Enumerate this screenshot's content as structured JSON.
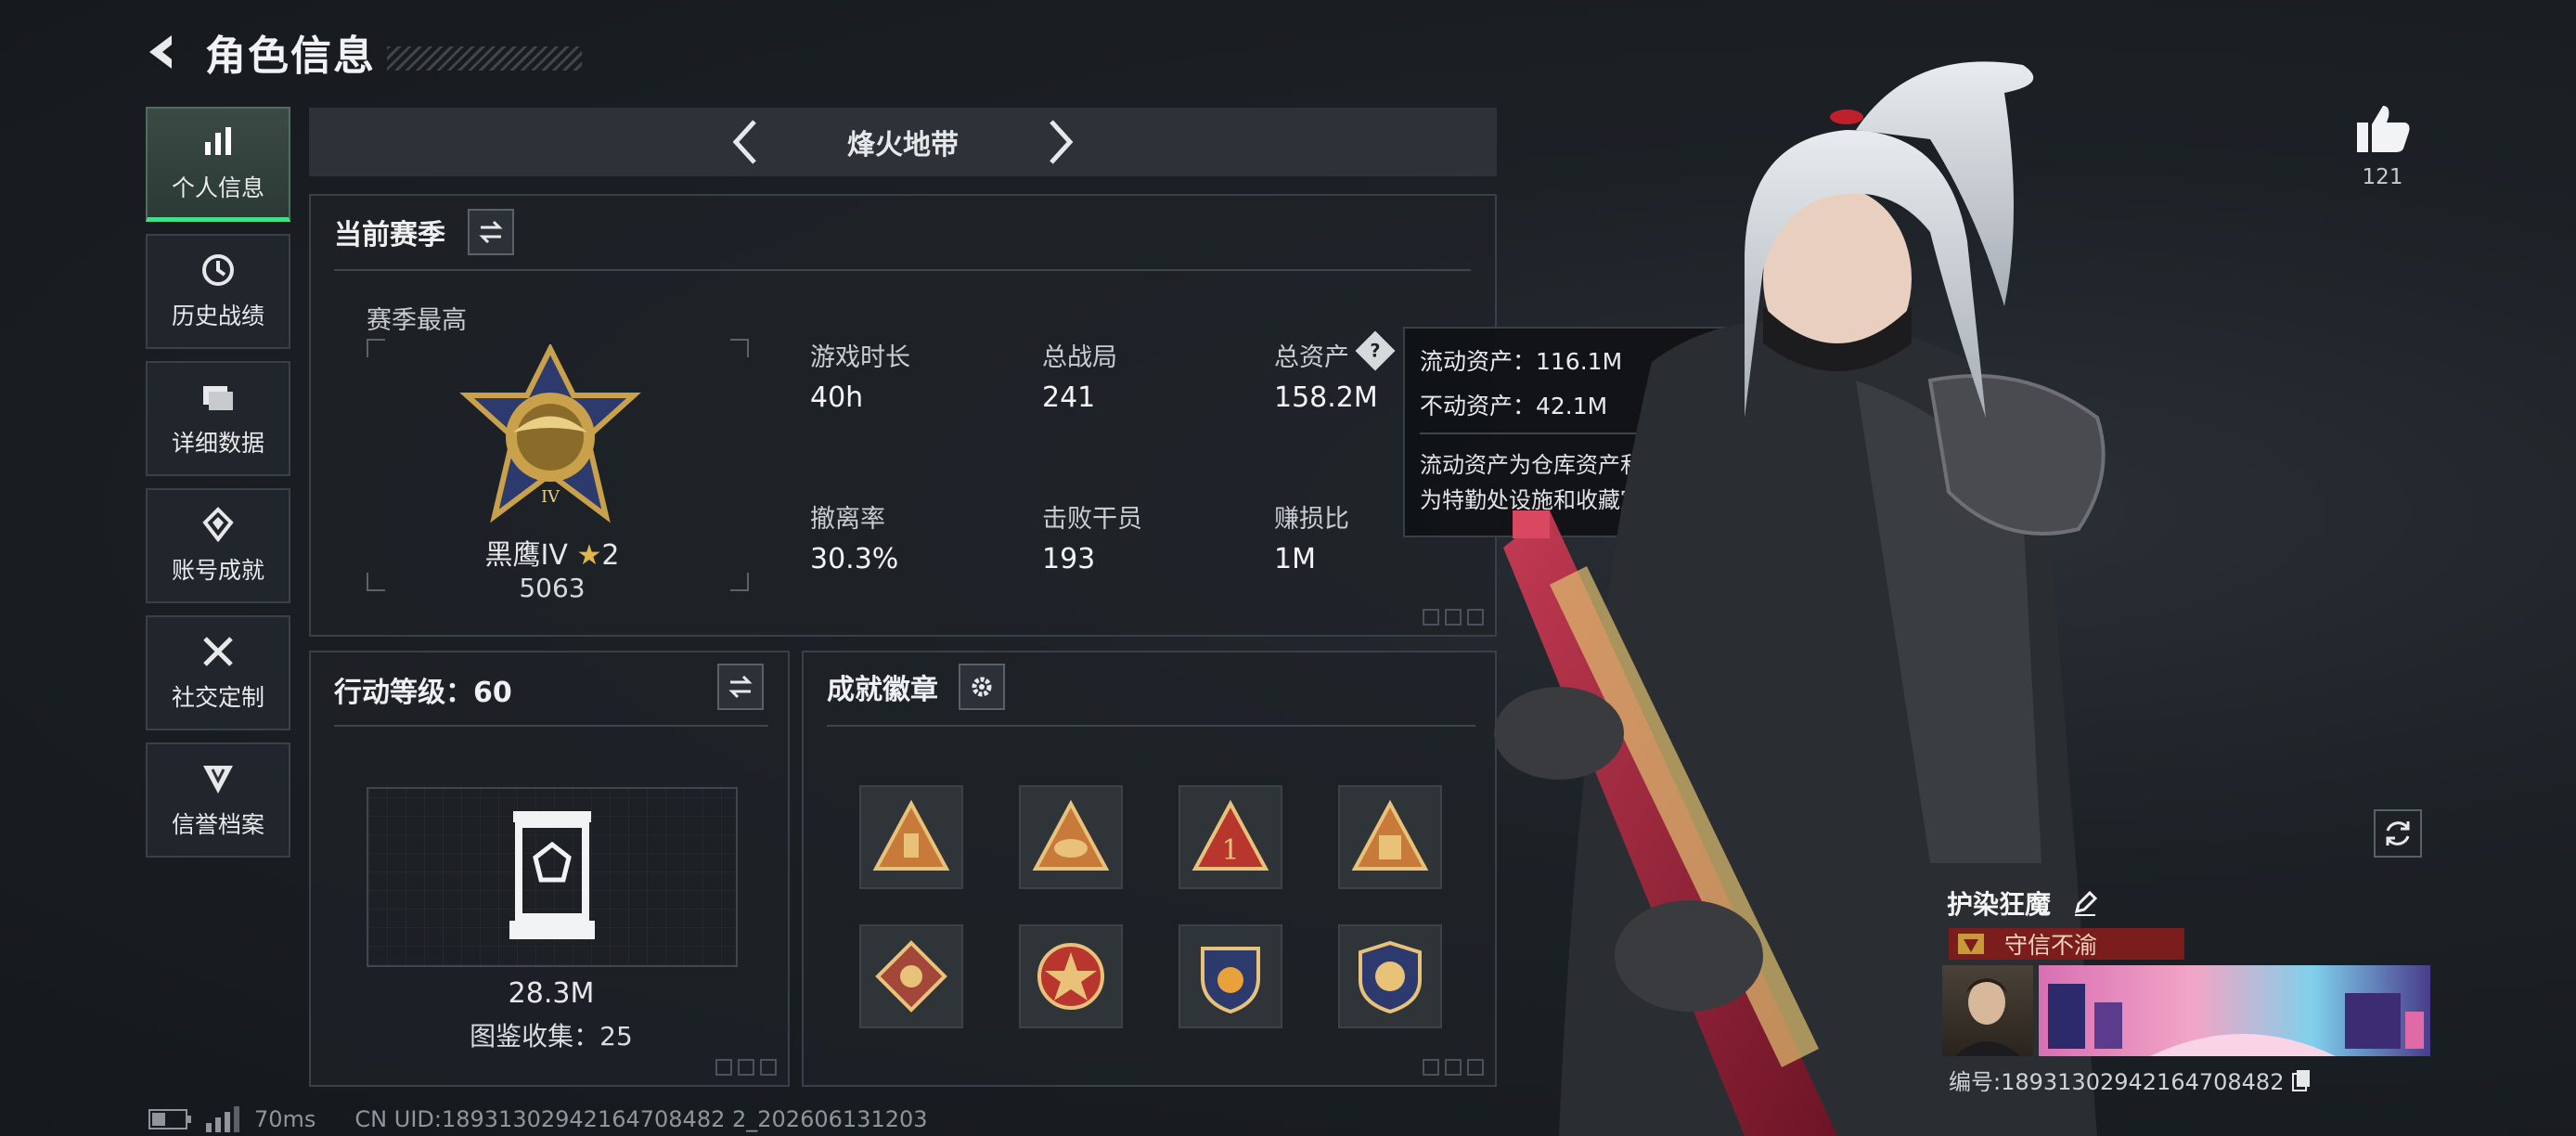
{
  "header": {
    "title": "角色信息"
  },
  "sidebar": {
    "items": [
      {
        "label": "个人信息",
        "icon": "bar-chart-icon",
        "active": true
      },
      {
        "label": "历史战绩",
        "icon": "history-clock-icon"
      },
      {
        "label": "详细数据",
        "icon": "folder-icon"
      },
      {
        "label": "账号成就",
        "icon": "achievement-icon"
      },
      {
        "label": "社交定制",
        "icon": "tools-icon"
      },
      {
        "label": "信誉档案",
        "icon": "credit-shield-icon"
      }
    ]
  },
  "map_bar": {
    "name": "烽火地带"
  },
  "season": {
    "title": "当前赛季",
    "best_label": "赛季最高",
    "rank_name": "黑鹰IV",
    "rank_stars": "2",
    "rank_score": "5063",
    "stats": [
      {
        "label": "游戏时长",
        "value": "40h"
      },
      {
        "label": "总战局",
        "value": "241"
      },
      {
        "label": "总资产",
        "value": "158.2M"
      },
      {
        "label": "撤离率",
        "value": "30.3%"
      },
      {
        "label": "击败干员",
        "value": "193"
      },
      {
        "label": "赚损比",
        "value": "1M"
      }
    ]
  },
  "tooltip": {
    "liquid": "流动资产：116.1M",
    "fixed": "不动资产：42.1M",
    "desc_line1": "流动资产为仓库资产和哈夫币，不动资产",
    "desc_line2": "为特勤处设施和收藏室设施"
  },
  "level": {
    "title": "行动等级：60",
    "value": "28.3M",
    "collection": "图鉴收集：25"
  },
  "achievements": {
    "title": "成就徽章",
    "badges": [
      "badge-1",
      "badge-2",
      "badge-3",
      "badge-4",
      "badge-5",
      "badge-6",
      "badge-7",
      "badge-8"
    ]
  },
  "status": {
    "ping": "70ms",
    "uid": "CN UID:18931302942164708482 2_202606131203"
  },
  "profile": {
    "likes": "121",
    "nickname": "护染狂魔",
    "credit": "守信不渝",
    "id_text": "编号:18931302942164708482"
  },
  "colors": {
    "accent_green": "#3fe089",
    "credit_red": "#7b1d1d",
    "gold": "#c8a14a"
  }
}
